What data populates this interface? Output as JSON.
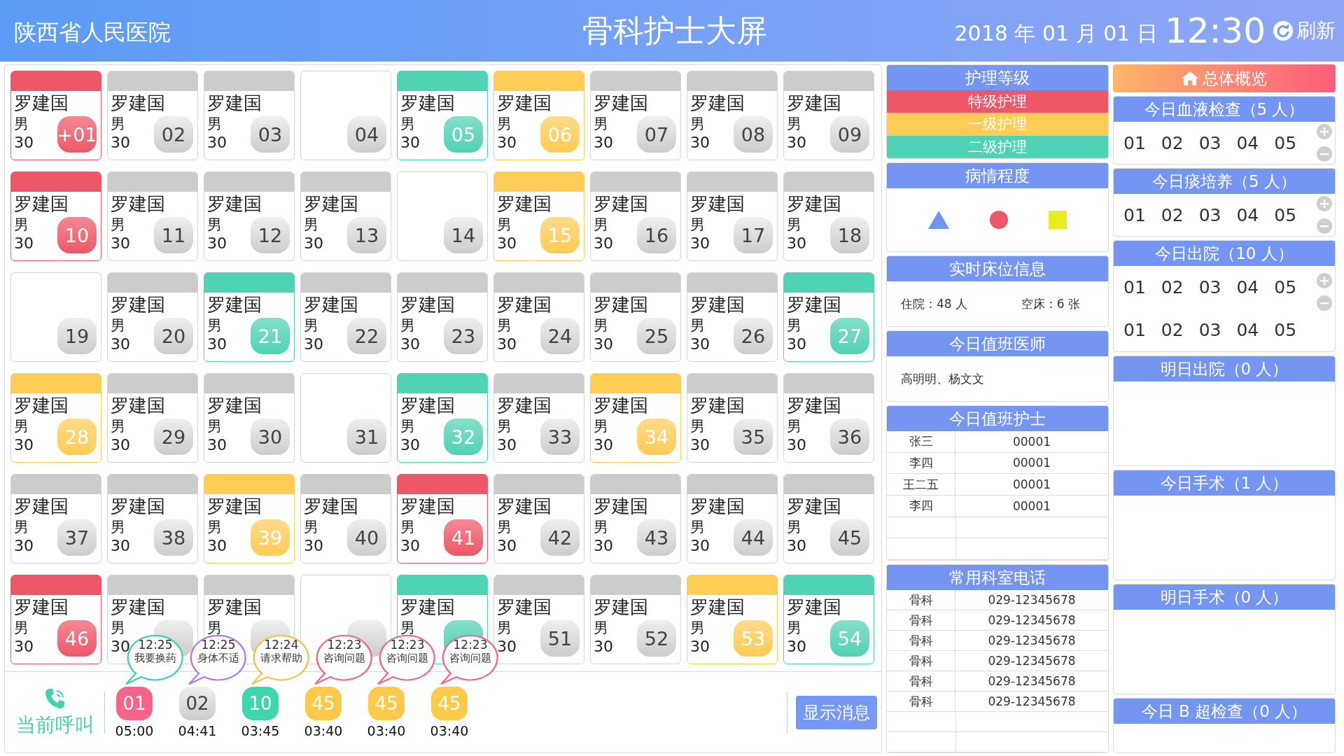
{
  "header": {
    "hospital": "陕西省人民医院",
    "title": "骨科护士大屏",
    "date": "2018 年 01 月 01 日",
    "time": "12:30",
    "refresh": "刷新"
  },
  "beds": [
    {
      "kind": "patient",
      "color": "#ee5767",
      "name": "罗建国",
      "sex": "男",
      "age": "30",
      "number": "+01"
    },
    {
      "kind": "patient",
      "color": "#cccccc",
      "name": "罗建国",
      "sex": "男",
      "age": "30",
      "number": "02"
    },
    {
      "kind": "patient",
      "color": "#cccccc",
      "name": "罗建国",
      "sex": "男",
      "age": "30",
      "number": "03"
    },
    {
      "kind": "empty",
      "number": "04"
    },
    {
      "kind": "patient",
      "color": "#50d2b4",
      "name": "罗建国",
      "sex": "男",
      "age": "30",
      "number": "05"
    },
    {
      "kind": "patient",
      "color": "#ffcc55",
      "name": "罗建国",
      "sex": "男",
      "age": "30",
      "number": "06"
    },
    {
      "kind": "patient",
      "color": "#cccccc",
      "name": "罗建国",
      "sex": "男",
      "age": "30",
      "number": "07"
    },
    {
      "kind": "patient",
      "color": "#cccccc",
      "name": "罗建国",
      "sex": "男",
      "age": "30",
      "number": "08"
    },
    {
      "kind": "patient",
      "color": "#cccccc",
      "name": "罗建国",
      "sex": "男",
      "age": "30",
      "number": "09"
    },
    {
      "kind": "patient",
      "color": "#ee5767",
      "name": "罗建国",
      "sex": "男",
      "age": "30",
      "number": "10"
    },
    {
      "kind": "patient",
      "color": "#cccccc",
      "name": "罗建国",
      "sex": "男",
      "age": "30",
      "number": "11"
    },
    {
      "kind": "patient",
      "color": "#cccccc",
      "name": "罗建国",
      "sex": "男",
      "age": "30",
      "number": "12"
    },
    {
      "kind": "patient",
      "color": "#cccccc",
      "name": "罗建国",
      "sex": "男",
      "age": "30",
      "number": "13"
    },
    {
      "kind": "empty",
      "number": "14"
    },
    {
      "kind": "patient",
      "color": "#ffcc55",
      "name": "罗建国",
      "sex": "男",
      "age": "30",
      "number": "15"
    },
    {
      "kind": "patient",
      "color": "#cccccc",
      "name": "罗建国",
      "sex": "男",
      "age": "30",
      "number": "16"
    },
    {
      "kind": "patient",
      "color": "#cccccc",
      "name": "罗建国",
      "sex": "男",
      "age": "30",
      "number": "17"
    },
    {
      "kind": "patient",
      "color": "#cccccc",
      "name": "罗建国",
      "sex": "男",
      "age": "30",
      "number": "18"
    },
    {
      "kind": "empty",
      "number": "19"
    },
    {
      "kind": "patient",
      "color": "#cccccc",
      "name": "罗建国",
      "sex": "男",
      "age": "30",
      "number": "20"
    },
    {
      "kind": "patient",
      "color": "#50d2b4",
      "name": "罗建国",
      "sex": "男",
      "age": "30",
      "number": "21"
    },
    {
      "kind": "patient",
      "color": "#cccccc",
      "name": "罗建国",
      "sex": "男",
      "age": "30",
      "number": "22"
    },
    {
      "kind": "patient",
      "color": "#cccccc",
      "name": "罗建国",
      "sex": "男",
      "age": "30",
      "number": "23"
    },
    {
      "kind": "patient",
      "color": "#cccccc",
      "name": "罗建国",
      "sex": "男",
      "age": "30",
      "number": "24"
    },
    {
      "kind": "patient",
      "color": "#cccccc",
      "name": "罗建国",
      "sex": "男",
      "age": "30",
      "number": "25"
    },
    {
      "kind": "patient",
      "color": "#cccccc",
      "name": "罗建国",
      "sex": "男",
      "age": "30",
      "number": "26"
    },
    {
      "kind": "patient",
      "color": "#50d2b4",
      "name": "罗建国",
      "sex": "男",
      "age": "30",
      "number": "27"
    },
    {
      "kind": "patient",
      "color": "#ffcc55",
      "name": "罗建国",
      "sex": "男",
      "age": "30",
      "number": "28"
    },
    {
      "kind": "patient",
      "color": "#cccccc",
      "name": "罗建国",
      "sex": "男",
      "age": "30",
      "number": "29"
    },
    {
      "kind": "patient",
      "color": "#cccccc",
      "name": "罗建国",
      "sex": "男",
      "age": "30",
      "number": "30"
    },
    {
      "kind": "empty",
      "number": "31"
    },
    {
      "kind": "patient",
      "color": "#50d2b4",
      "name": "罗建国",
      "sex": "男",
      "age": "30",
      "number": "32"
    },
    {
      "kind": "patient",
      "color": "#cccccc",
      "name": "罗建国",
      "sex": "男",
      "age": "30",
      "number": "33"
    },
    {
      "kind": "patient",
      "color": "#ffcc55",
      "name": "罗建国",
      "sex": "男",
      "age": "30",
      "number": "34"
    },
    {
      "kind": "patient",
      "color": "#cccccc",
      "name": "罗建国",
      "sex": "男",
      "age": "30",
      "number": "35"
    },
    {
      "kind": "patient",
      "color": "#cccccc",
      "name": "罗建国",
      "sex": "男",
      "age": "30",
      "number": "36"
    },
    {
      "kind": "patient",
      "color": "#cccccc",
      "name": "罗建国",
      "sex": "男",
      "age": "30",
      "number": "37"
    },
    {
      "kind": "patient",
      "color": "#cccccc",
      "name": "罗建国",
      "sex": "男",
      "age": "30",
      "number": "38"
    },
    {
      "kind": "patient",
      "color": "#ffcc55",
      "name": "罗建国",
      "sex": "男",
      "age": "30",
      "number": "39"
    },
    {
      "kind": "patient",
      "color": "#cccccc",
      "name": "罗建国",
      "sex": "男",
      "age": "30",
      "number": "40"
    },
    {
      "kind": "patient",
      "color": "#ee5767",
      "name": "罗建国",
      "sex": "男",
      "age": "30",
      "number": "41"
    },
    {
      "kind": "patient",
      "color": "#cccccc",
      "name": "罗建国",
      "sex": "男",
      "age": "30",
      "number": "42"
    },
    {
      "kind": "patient",
      "color": "#cccccc",
      "name": "罗建国",
      "sex": "男",
      "age": "30",
      "number": "43"
    },
    {
      "kind": "patient",
      "color": "#cccccc",
      "name": "罗建国",
      "sex": "男",
      "age": "30",
      "number": "44"
    },
    {
      "kind": "patient",
      "color": "#cccccc",
      "name": "罗建国",
      "sex": "男",
      "age": "30",
      "number": "45"
    },
    {
      "kind": "patient",
      "color": "#ee5767",
      "name": "罗建国",
      "sex": "男",
      "age": "30",
      "number": "46"
    },
    {
      "kind": "patient",
      "color": "#cccccc",
      "name": "罗建国",
      "sex": "男",
      "age": "30"
    },
    {
      "kind": "patient",
      "color": "#cccccc",
      "name": "罗建国",
      "sex": "男"
    },
    {
      "kind": "empty"
    },
    {
      "kind": "patient",
      "color": "#50d2b4",
      "name": "罗建国",
      "sex": "男"
    },
    {
      "kind": "patient",
      "color": "#cccccc",
      "name": "罗建国",
      "sex": "男",
      "age": "30",
      "number": "51"
    },
    {
      "kind": "patient",
      "color": "#cccccc",
      "name": "罗建国",
      "sex": "男",
      "age": "30",
      "number": "52"
    },
    {
      "kind": "patient",
      "color": "#ffcc55",
      "name": "罗建国",
      "sex": "男",
      "age": "30",
      "number": "53"
    },
    {
      "kind": "patient",
      "color": "#50d2b4",
      "name": "罗建国",
      "sex": "男",
      "age": "30",
      "number": "54"
    }
  ],
  "calls": {
    "label": "当前呼叫",
    "button": "显示消息",
    "items": [
      {
        "bubble": {
          "time": "12:25",
          "message": "我要换药",
          "color": "#3fd3ad"
        },
        "color": "#f6648a",
        "number": "01",
        "waited": "05:00"
      },
      {
        "bubble": {
          "time": "12:25",
          "message": "身体不适",
          "color": "#b77be0"
        },
        "color": "#cccccc",
        "number": "02",
        "waited": "04:41"
      },
      {
        "bubble": {
          "time": "12:24",
          "message": "请求帮助",
          "color": "#f3c54a"
        },
        "color": "#3dd6ad",
        "number": "10",
        "waited": "03:45"
      },
      {
        "bubble": {
          "time": "12:23",
          "message": "咨询问题",
          "color": "#ec6b8e"
        },
        "color": "#ffc94a",
        "number": "45",
        "waited": "03:40"
      },
      {
        "bubble": {
          "time": "12:23",
          "message": "咨询问题",
          "color": "#ec6b8e"
        },
        "color": "#ffc94a",
        "number": "45",
        "waited": "03:40"
      },
      {
        "bubble": {
          "time": "12:23",
          "message": "咨询问题",
          "color": "#ec6b8e"
        },
        "color": "#ffc94a",
        "number": "45",
        "waited": "03:40"
      }
    ]
  },
  "legend": {
    "title": "护理等级",
    "items": [
      {
        "label": "特级护理",
        "color": "#ee5767"
      },
      {
        "label": "一级护理",
        "color": "#ffcc55"
      },
      {
        "label": "二级护理",
        "color": "#50d2b4"
      }
    ]
  },
  "severity": {
    "title": "病情程度"
  },
  "bed_info": {
    "title": "实时床位信息",
    "occupied": "住院：48 人",
    "vacant": "空床：6 张"
  },
  "doctors": {
    "title": "今日值班医师",
    "names": "高明明、杨文文"
  },
  "nurses": {
    "title": "今日值班护士",
    "rows": [
      [
        "张三",
        "00001"
      ],
      [
        "李四",
        "00001"
      ],
      [
        "王二五",
        "00001"
      ],
      [
        "李四",
        "00001"
      ]
    ]
  },
  "phones": {
    "title": "常用科室电话",
    "rows": [
      [
        "骨科",
        "029-12345678"
      ],
      [
        "骨科",
        "029-12345678"
      ],
      [
        "骨科",
        "029-12345678"
      ],
      [
        "骨科",
        "029-12345678"
      ],
      [
        "骨科",
        "029-12345678"
      ],
      [
        "骨科",
        "029-12345678"
      ]
    ]
  },
  "overview": {
    "title": "总体概览",
    "panels": [
      {
        "title": "今日血液检查（5 人）",
        "controls": true,
        "rows": [
          [
            "01",
            "02",
            "03",
            "04",
            "05"
          ]
        ]
      },
      {
        "title": "今日痰培养（5 人）",
        "controls": true,
        "rows": [
          [
            "01",
            "02",
            "03",
            "04",
            "05"
          ]
        ]
      },
      {
        "title": "今日出院（10 人）",
        "controls": true,
        "rows": [
          [
            "01",
            "02",
            "03",
            "04",
            "05"
          ],
          [
            "01",
            "02",
            "03",
            "04",
            "05"
          ]
        ]
      },
      {
        "title": "明日出院（0 人）",
        "controls": false
      },
      {
        "title": "今日手术（1 人）",
        "controls": false
      },
      {
        "title": "明日手术（0 人）",
        "controls": false
      },
      {
        "title": "今日 B 超检查（0 人）",
        "controls": false
      }
    ]
  }
}
